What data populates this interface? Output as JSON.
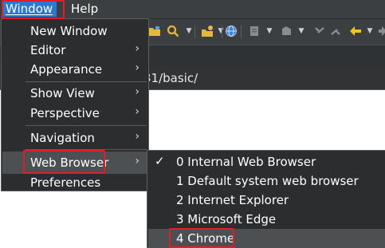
{
  "menubar": {
    "window_label": "Window",
    "help_label": "Help"
  },
  "address": {
    "path_fragment": "31/basic/"
  },
  "window_menu": {
    "items": [
      {
        "label": "New Window",
        "has_submenu": false
      },
      {
        "label": "Editor",
        "has_submenu": true,
        "arrow": "›"
      },
      {
        "label": "Appearance",
        "has_submenu": true,
        "arrow": "›"
      },
      {
        "label": "Show View",
        "has_submenu": true,
        "arrow": "›"
      },
      {
        "label": "Perspective",
        "has_submenu": true,
        "arrow": "›"
      },
      {
        "label": "Navigation",
        "has_submenu": true,
        "arrow": "›"
      },
      {
        "label": "Web Browser",
        "has_submenu": true,
        "arrow": "›",
        "highlighted": true
      },
      {
        "label": "Preferences",
        "has_submenu": false
      }
    ]
  },
  "web_browser_menu": {
    "items": [
      {
        "label": "0 Internal Web Browser",
        "checked": true,
        "check": "✓"
      },
      {
        "label": "1 Default system web browser",
        "checked": false
      },
      {
        "label": "2 Internet Explorer",
        "checked": false
      },
      {
        "label": "3 Microsoft Edge",
        "checked": false
      },
      {
        "label": "4 Chrome",
        "checked": false,
        "highlighted": true
      }
    ]
  },
  "colors": {
    "menu_background": "#2b2d2f",
    "menubar_selected": "#2a78d6",
    "highlight_box": "#e01e28",
    "content_background": "#ffffff"
  }
}
